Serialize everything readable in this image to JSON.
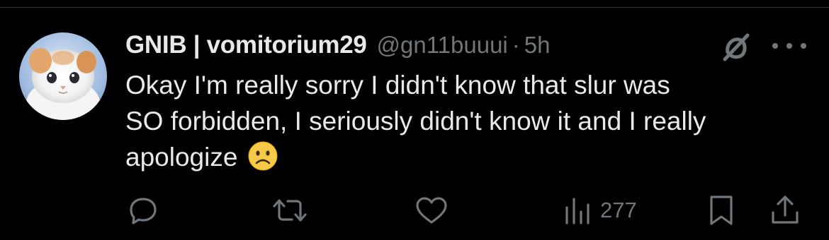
{
  "tweet": {
    "display_name": "GNIB | vomitorium29",
    "handle": "@gn11buuui",
    "separator": "·",
    "time": "5h",
    "text_lines": [
      "Okay I'm really sorry I didn't know that slur was",
      "SO forbidden, I seriously didn't know it and I really",
      "apologize"
    ],
    "emoji": "frowning-face",
    "views": "277"
  },
  "icons": {
    "grok": "grok-icon",
    "more": "more-icon",
    "reply": "reply-icon",
    "repost": "repost-icon",
    "like": "like-icon",
    "views": "views-icon",
    "bookmark": "bookmark-icon",
    "share": "share-icon"
  },
  "colors": {
    "background": "#000000",
    "text": "#e7e9ea",
    "secondary": "#71767b",
    "emoji": "#f7c948"
  }
}
